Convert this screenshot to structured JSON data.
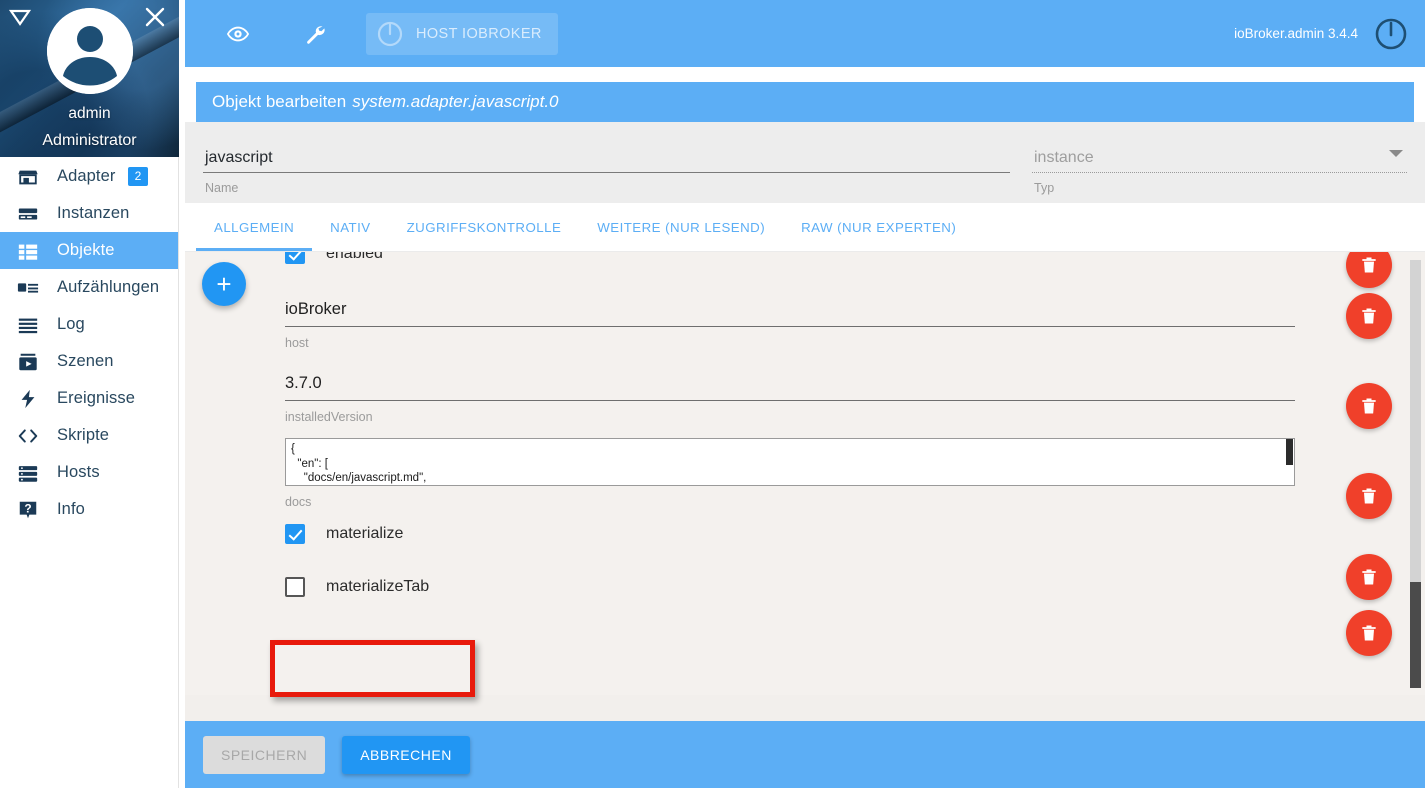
{
  "sidebar": {
    "profile": {
      "name": "admin",
      "role": "Administrator",
      "collapse_icon": "collapse-triangle-icon",
      "close_icon": "close-icon",
      "avatar_icon": "user-avatar-icon"
    },
    "items": [
      {
        "label": "Adapter",
        "icon": "store-icon",
        "badge": "2",
        "active": false
      },
      {
        "label": "Instanzen",
        "icon": "instances-icon",
        "badge": null,
        "active": false
      },
      {
        "label": "Objekte",
        "icon": "objects-icon",
        "badge": null,
        "active": true
      },
      {
        "label": "Aufzählungen",
        "icon": "enums-icon",
        "badge": null,
        "active": false
      },
      {
        "label": "Log",
        "icon": "log-icon",
        "badge": null,
        "active": false
      },
      {
        "label": "Szenen",
        "icon": "scenes-icon",
        "badge": null,
        "active": false
      },
      {
        "label": "Ereignisse",
        "icon": "events-icon",
        "badge": null,
        "active": false
      },
      {
        "label": "Skripte",
        "icon": "scripts-icon",
        "badge": null,
        "active": false
      },
      {
        "label": "Hosts",
        "icon": "hosts-icon",
        "badge": null,
        "active": false
      },
      {
        "label": "Info",
        "icon": "info-icon",
        "badge": null,
        "active": false
      }
    ]
  },
  "topbar": {
    "eye_icon": "eye-icon",
    "wrench_icon": "wrench-icon",
    "host_button_label": "HOST IOBROKER",
    "host_power_icon": "power-icon",
    "version": "ioBroker.admin 3.4.4",
    "logout_icon": "power-logout-icon"
  },
  "dialog": {
    "title_prefix": "Objekt bearbeiten",
    "title_object": "system.adapter.javascript.0",
    "name_field": {
      "value": "javascript",
      "helper": "Name"
    },
    "type_field": {
      "value": "instance",
      "helper": "Typ",
      "caret_icon": "chevron-down-icon"
    },
    "tabs": [
      {
        "label": "ALLGEMEIN",
        "active": true
      },
      {
        "label": "NATIV",
        "active": false
      },
      {
        "label": "ZUGRIFFSKONTROLLE",
        "active": false
      },
      {
        "label": "WEITERE (NUR LESEND)",
        "active": false
      },
      {
        "label": "RAW (NUR EXPERTEN)",
        "active": false
      }
    ],
    "add_button_label": "+",
    "rows": [
      {
        "kind": "checkbox",
        "label": "enabled",
        "checked": true,
        "clipped": true
      },
      {
        "kind": "text",
        "value": "ioBroker",
        "helper": "host"
      },
      {
        "kind": "text",
        "value": "3.7.0",
        "helper": "installedVersion"
      },
      {
        "kind": "textarea",
        "value": "{\n  \"en\": [\n    \"docs/en/javascript.md\",\n    \"docs/en/blockly.md\"",
        "helper": "docs"
      },
      {
        "kind": "checkbox",
        "label": "materialize",
        "checked": true,
        "clipped": false
      },
      {
        "kind": "checkbox",
        "label": "materializeTab",
        "checked": false,
        "clipped": false
      }
    ],
    "delete_buttons": [
      {
        "icon": "trash-icon"
      },
      {
        "icon": "trash-icon"
      },
      {
        "icon": "trash-icon"
      },
      {
        "icon": "trash-icon"
      },
      {
        "icon": "trash-icon"
      },
      {
        "icon": "trash-icon"
      }
    ],
    "footer": {
      "save_label": "SPEICHERN",
      "cancel_label": "ABBRECHEN"
    }
  },
  "colors": {
    "accent_blue": "#5CAEF5",
    "button_blue": "#2196f3",
    "delete_red": "#f0402a",
    "annotation_red": "#e81a0c",
    "content_bg": "#f4f1ee"
  }
}
